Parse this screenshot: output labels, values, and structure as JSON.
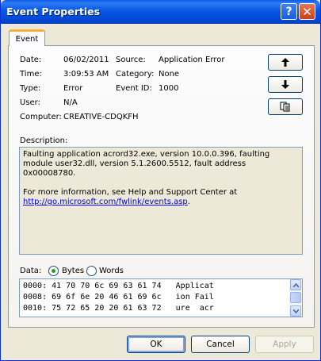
{
  "window": {
    "title": "Event Properties",
    "help_glyph": "?",
    "close_glyph": "✕"
  },
  "tabs": [
    {
      "label": "Event",
      "selected": true
    }
  ],
  "event": {
    "date_label": "Date:",
    "date": "06/02/2011",
    "time_label": "Time:",
    "time": "3:09:53 AM",
    "type_label": "Type:",
    "type": "Error",
    "user_label": "User:",
    "user": "N/A",
    "computer_label": "Computer:",
    "computer": "CREATIVE-CDQKFH",
    "source_label": "Source:",
    "source": "Application Error",
    "category_label": "Category:",
    "category": "None",
    "event_id_label": "Event ID:",
    "event_id": "1000"
  },
  "side_buttons": [
    {
      "name": "previous-event",
      "icon": "arrow-up-icon",
      "glyph": "🡅"
    },
    {
      "name": "next-event",
      "icon": "arrow-down-icon",
      "glyph": "🡇"
    },
    {
      "name": "copy",
      "icon": "copy-icon",
      "glyph": "⧉"
    }
  ],
  "description": {
    "label": "Description:",
    "line1": "Faulting application acrord32.exe, version 10.0.0.396, faulting module user32.dll, version 5.1.2600.5512, fault address 0x00008780.",
    "line2": "For more information, see Help and Support Center at",
    "link": "http://go.microsoft.com/fwlink/events.asp",
    "link_suffix": "."
  },
  "data": {
    "label": "Data:",
    "bytes_label": "Bytes",
    "words_label": "Words",
    "selected": "Bytes",
    "rows": [
      "0000: 41 70 70 6c 69 63 61 74   Applicat",
      "0008: 69 6f 6e 20 46 61 69 6c   ion Fail",
      "0010: 75 72 65 20 20 61 63 72   ure  acr"
    ]
  },
  "buttons": {
    "ok": "OK",
    "cancel": "Cancel",
    "apply": "Apply"
  },
  "colors": {
    "titlebar": "#0054e3",
    "face": "#ece9d8",
    "tab_highlight": "#f9b13c",
    "link": "#0000ee"
  }
}
